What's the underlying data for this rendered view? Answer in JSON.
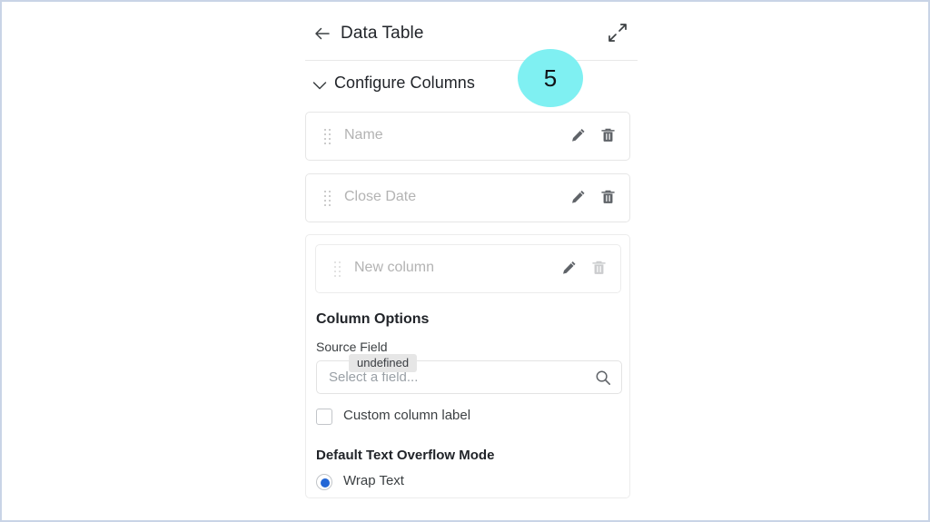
{
  "window": {
    "border_color": "#c9d4e6",
    "background": "#ffffff"
  },
  "header": {
    "back_icon": "arrow-left-icon",
    "title": "Data Table",
    "expand_icon": "expand-diagonal-icon"
  },
  "section": {
    "chevron_icon": "chevron-down-icon",
    "title": "Configure Columns",
    "expanded": true
  },
  "step_badge": {
    "number": "5",
    "color": "#7ff0f2"
  },
  "columns": [
    {
      "label": "Name",
      "drag_icon": "drag-handle-icon",
      "edit_icon": "pencil-icon",
      "delete_icon": "trash-icon",
      "delete_disabled": false
    },
    {
      "label": "Close Date",
      "drag_icon": "drag-handle-icon",
      "edit_icon": "pencil-icon",
      "delete_icon": "trash-icon",
      "delete_disabled": false
    }
  ],
  "new_column": {
    "label": "New column",
    "drag_icon": "drag-handle-icon",
    "edit_icon": "pencil-icon",
    "delete_icon": "trash-icon",
    "delete_disabled": true
  },
  "column_options": {
    "title": "Column Options",
    "source_field": {
      "label": "Source Field",
      "placeholder": "Select a field...",
      "value": "",
      "search_icon": "search-icon"
    },
    "tooltip": {
      "text": "undefined",
      "background": "#e6e6e6"
    },
    "custom_label_checkbox": {
      "label": "Custom column label",
      "checked": false
    },
    "overflow": {
      "title": "Default Text Overflow Mode",
      "options": [
        {
          "label": "Wrap Text",
          "selected": true
        }
      ],
      "accent_color": "#2266d6"
    }
  }
}
